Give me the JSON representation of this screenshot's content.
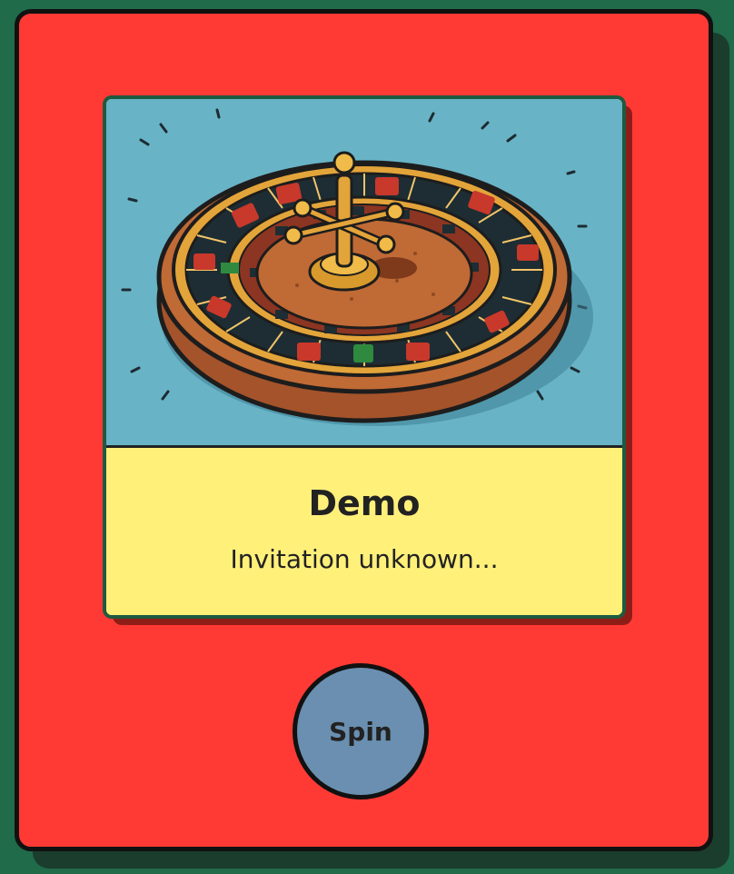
{
  "card": {
    "title": "Demo",
    "subtitle": "Invitation unknown...",
    "image": "roulette-wheel-illustration"
  },
  "controls": {
    "spin_label": "Spin"
  },
  "colors": {
    "background": "#1f6b4a",
    "frame": "#ff3a34",
    "card_image_bg": "#69b3c6",
    "card_body_bg": "#fff07a",
    "button": "#6a8fb0"
  }
}
